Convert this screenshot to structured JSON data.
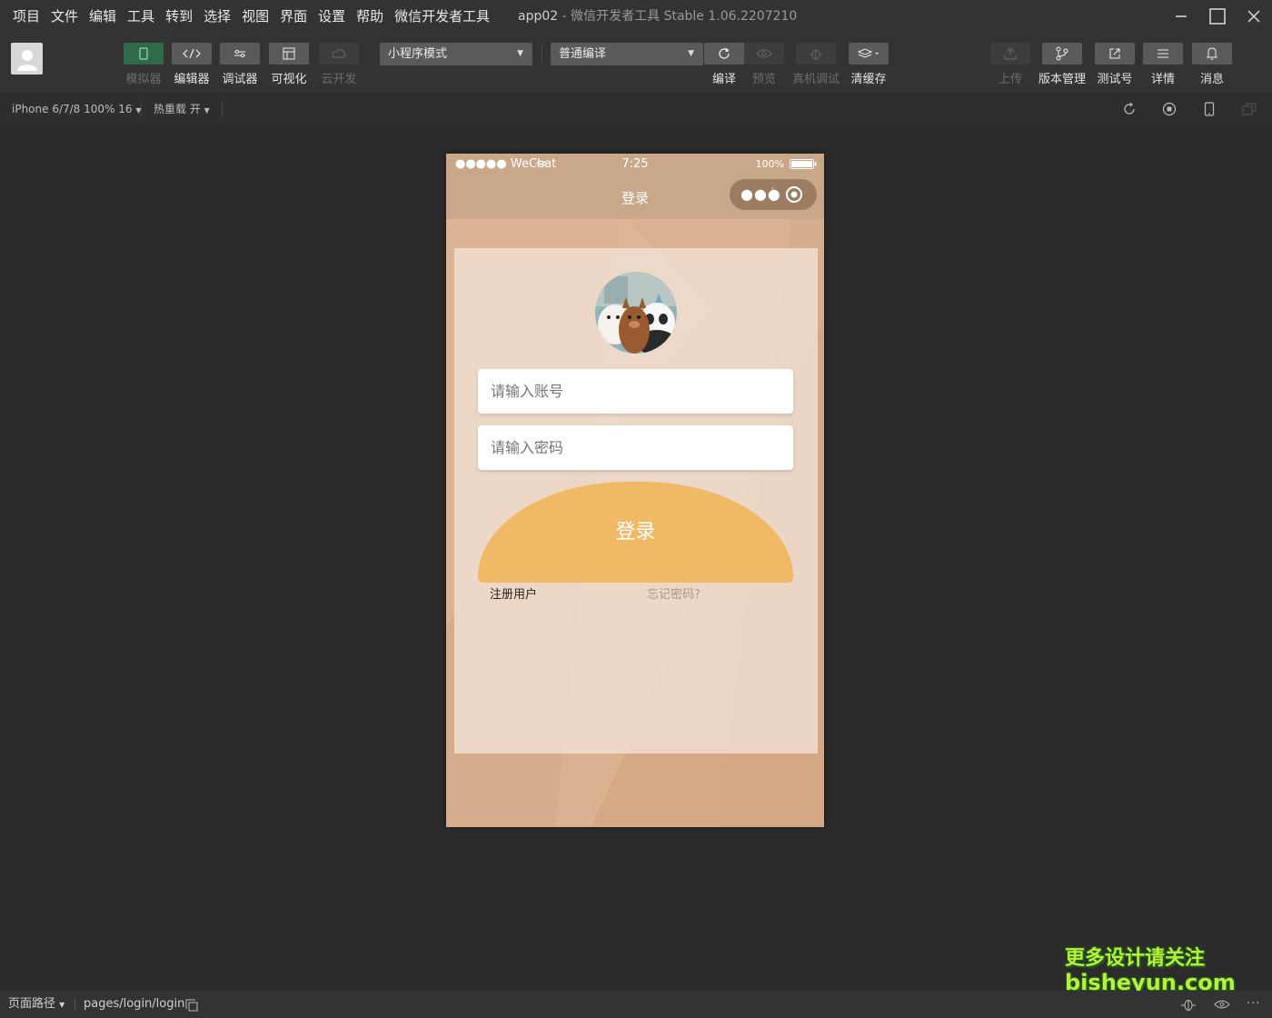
{
  "menubar": {
    "items": [
      "项目",
      "文件",
      "编辑",
      "工具",
      "转到",
      "选择",
      "视图",
      "界面",
      "设置",
      "帮助",
      "微信开发者工具"
    ],
    "app_name": "app02",
    "window_title": " - 微信开发者工具 Stable 1.06.2207210"
  },
  "toolbar": {
    "simulator": "模拟器",
    "editor": "编辑器",
    "debugger": "调试器",
    "visual": "可视化",
    "cloud": "云开发",
    "mode_select": "小程序模式",
    "compile_select": "普通编译",
    "compile": "编译",
    "preview": "预览",
    "device_debug": "真机调试",
    "clear_cache": "清缓存",
    "upload": "上传",
    "version": "版本管理",
    "test_account": "测试号",
    "details": "详情",
    "messages": "消息"
  },
  "subbar": {
    "device": "iPhone 6/7/8 100% 16",
    "hot_reload": "热重载 开"
  },
  "phone": {
    "carrier": "●●●●● WeChat",
    "time": "7:25",
    "battery": "100%",
    "nav_title": "登录",
    "account_placeholder": "请输入账号",
    "password_placeholder": "请输入密码",
    "login_button": "登录",
    "register_link": "注册用户",
    "forgot_link": "忘记密码?"
  },
  "bottombar": {
    "page_path_label": "页面路径",
    "page_path": "pages/login/login"
  },
  "watermark": {
    "line1": "更多设计请关注",
    "line2": "bisheyun.com"
  },
  "colors": {
    "phone_bg": "#d1aa89",
    "login_button": "#f0b965",
    "simulator_active": "#2f6b4a"
  }
}
